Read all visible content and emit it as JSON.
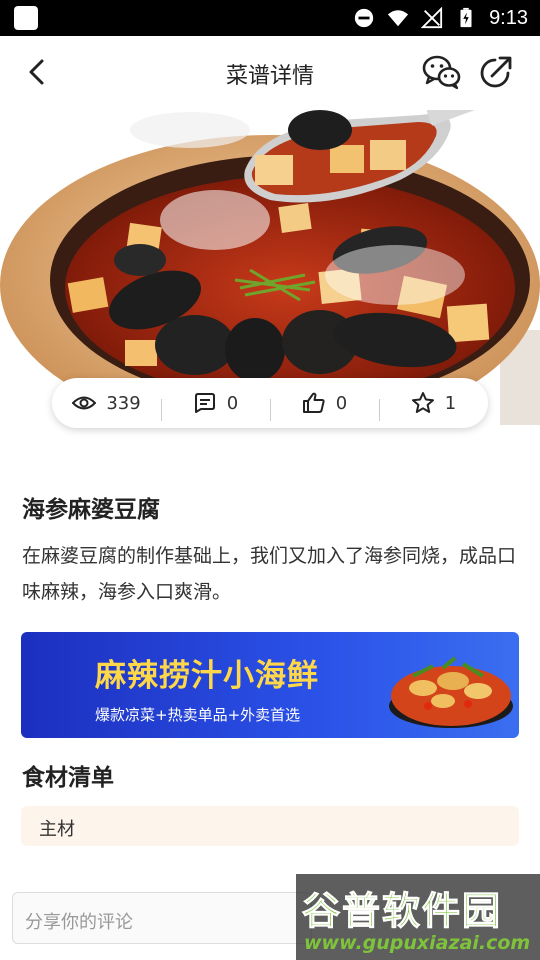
{
  "status_bar": {
    "time": "9:13"
  },
  "nav": {
    "title": "菜谱详情"
  },
  "stats": {
    "views": "339",
    "comments": "0",
    "likes": "0",
    "favorites": "1"
  },
  "recipe": {
    "name": "海参麻婆豆腐",
    "description": "在麻婆豆腐的制作基础上，我们又加入了海参同烧，成品口味麻辣，海参入口爽滑。"
  },
  "banner": {
    "title": "麻辣捞汁小海鲜",
    "subtitle": "爆款凉菜+热卖单品+外卖首选"
  },
  "ingredients": {
    "title": "食材清单",
    "main_label": "主材"
  },
  "comment": {
    "placeholder": "分享你的评论"
  },
  "watermark": {
    "name": "谷普软件园",
    "url": "www.gupuxiazai.com"
  },
  "colors": {
    "accent_yellow": "#ffd84a",
    "banner_blue": "#2b52e8",
    "tag_bg": "#fdf4ec",
    "watermark_green": "#7ec33a"
  }
}
